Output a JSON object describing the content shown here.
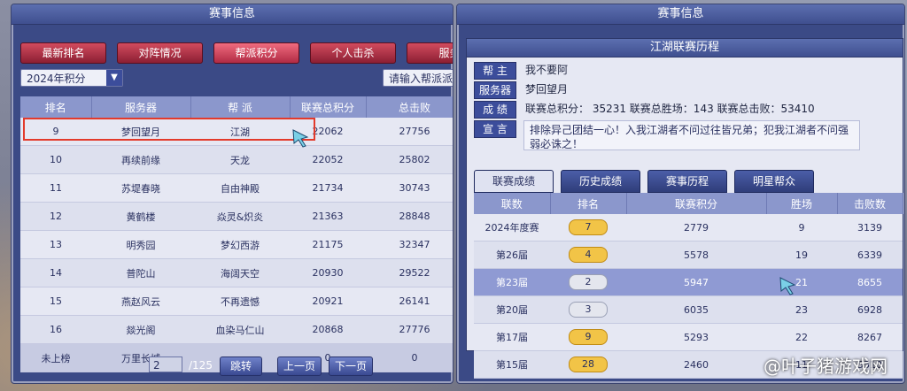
{
  "left": {
    "title": "赛事信息",
    "tabs": [
      {
        "label": "最新排名",
        "active": false
      },
      {
        "label": "对阵情况",
        "active": false
      },
      {
        "label": "帮派积分",
        "active": true
      },
      {
        "label": "个人击杀",
        "active": false
      },
      {
        "label": "服务",
        "active": false
      }
    ],
    "season_select": "2024年积分",
    "search_placeholder": "请输入帮派派",
    "columns": [
      "排名",
      "服务器",
      "帮 派",
      "联赛总积分",
      "总击败"
    ],
    "rows": [
      [
        "9",
        "梦回望月",
        "江湖",
        "22062",
        "27756"
      ],
      [
        "10",
        "再续前缘",
        "天龙",
        "22052",
        "25802"
      ],
      [
        "11",
        "苏堤春晓",
        "自由神殿",
        "21734",
        "30743"
      ],
      [
        "12",
        "黄鹤楼",
        "焱灵&炽炎",
        "21363",
        "28848"
      ],
      [
        "13",
        "明秀园",
        "梦幻西游",
        "21175",
        "32347"
      ],
      [
        "14",
        "普陀山",
        "海阔天空",
        "20930",
        "29522"
      ],
      [
        "15",
        "燕赵风云",
        "不再遗憾",
        "20921",
        "26141"
      ],
      [
        "16",
        "燚光阁",
        "血染马仁山",
        "20868",
        "27776"
      ],
      [
        "未上榜",
        "万里长城",
        "",
        "0",
        "0"
      ]
    ],
    "pager": {
      "current": "2",
      "total": "/125",
      "jump": "跳转",
      "prev": "上一页",
      "next": "下一页"
    }
  },
  "right": {
    "title": "赛事信息",
    "subtitle": "江湖联赛历程",
    "info": {
      "leader_label": "帮 主",
      "leader": "我不要阿",
      "server_label": "服务器",
      "server": "梦回望月",
      "score_label": "成 绩",
      "score": "联赛总积分： 35231  联赛总胜场：143  联赛总击败：53410",
      "decl_label": "宣 言",
      "declaration": "排除异己团结一心！入我江湖者不问过往皆兄弟；犯我江湖者不问强弱必诛之！"
    },
    "tabs": [
      {
        "label": "联赛成绩",
        "active": true
      },
      {
        "label": "历史成绩",
        "active": false
      },
      {
        "label": "赛事历程",
        "active": false
      },
      {
        "label": "明星帮众",
        "active": false
      }
    ],
    "columns": [
      "联数",
      "排名",
      "联赛积分",
      "胜场",
      "击败数"
    ],
    "rows": [
      {
        "season": "2024年度赛",
        "rank": "7",
        "badge": "gold",
        "points": "2779",
        "wins": "9",
        "kills": "3139"
      },
      {
        "season": "第26届",
        "rank": "4",
        "badge": "gold",
        "points": "5578",
        "wins": "19",
        "kills": "6339"
      },
      {
        "season": "第23届",
        "rank": "2",
        "badge": "silver",
        "points": "5947",
        "wins": "21",
        "kills": "8655",
        "selected": true
      },
      {
        "season": "第20届",
        "rank": "3",
        "badge": "silver",
        "points": "6035",
        "wins": "23",
        "kills": "6928"
      },
      {
        "season": "第17届",
        "rank": "9",
        "badge": "gold",
        "points": "5293",
        "wins": "22",
        "kills": "8267"
      },
      {
        "season": "第15届",
        "rank": "28",
        "badge": "gold",
        "points": "2460",
        "wins": "11",
        "kills": "5310"
      }
    ]
  },
  "watermark": "@叶子猪游戏网"
}
